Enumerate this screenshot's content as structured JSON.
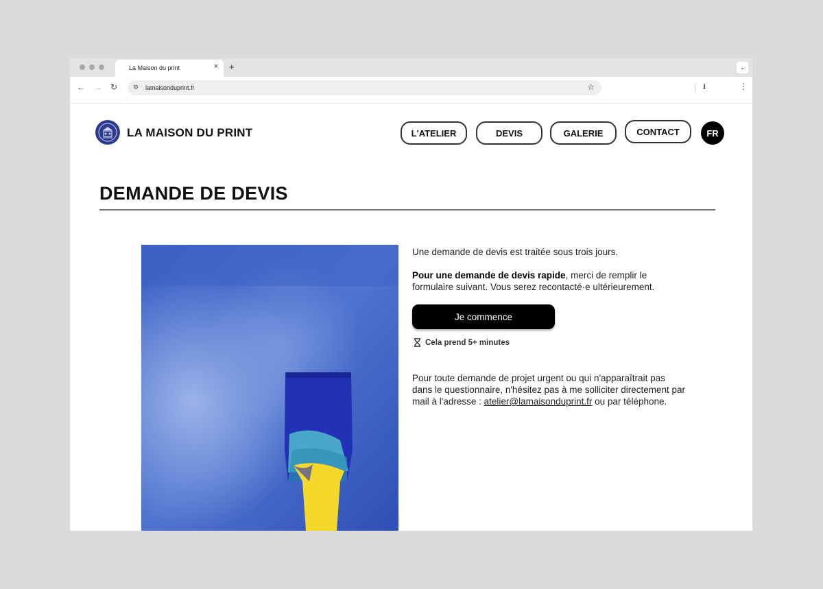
{
  "browser": {
    "tab_title": "La Maison du print",
    "tab_close": "×",
    "new_tab": "+",
    "url": "lamaisonduprint.fr"
  },
  "site": {
    "brand": "LA MAISON DU PRINT",
    "nav": [
      "L'ATELIER",
      "DEVIS",
      "GALERIE",
      "CONTACT"
    ],
    "language": "FR"
  },
  "main": {
    "title": "DEMANDE DE DEVIS",
    "intro": "Une demande de devis est traitée sous trois jours.",
    "quick_bold": "Pour une demande de devis rapide",
    "quick_rest": ", merci de remplir le formulaire suivant. Vous serez recontacté·e ultérieurement.",
    "start_button": "Je commence",
    "duration": "Cela prend 5+ minutes",
    "urgent_text": "Pour toute demande de projet urgent ou qui n'apparaîtrait pas dans le questionnaire, n'hésitez pas à me solliciter directement par mail à l'adresse : ",
    "email": "atelier@lamaisonduprint.fr",
    "urgent_end": " ou par téléphone."
  },
  "colors": {
    "background": "#dbdbdb",
    "accent_blue": "#2d3b8c",
    "button": "#000000"
  }
}
